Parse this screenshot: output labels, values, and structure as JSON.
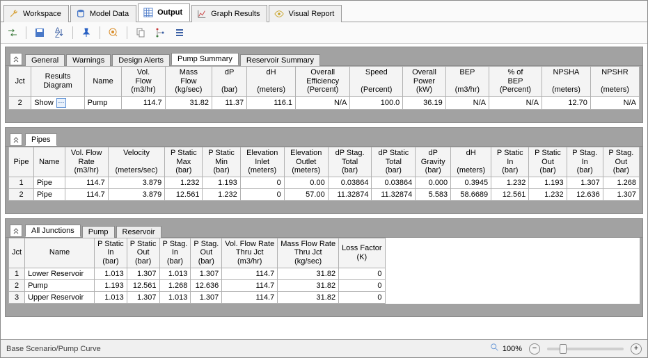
{
  "mainTabs": [
    {
      "label": "Workspace",
      "icon": "wrench"
    },
    {
      "label": "Model Data",
      "icon": "database"
    },
    {
      "label": "Output",
      "icon": "grid",
      "active": true
    },
    {
      "label": "Graph Results",
      "icon": "chart"
    },
    {
      "label": "Visual Report",
      "icon": "eye"
    }
  ],
  "panel1": {
    "subTabs": [
      "General",
      "Warnings",
      "Design Alerts",
      "Pump Summary",
      "Reservoir Summary"
    ],
    "activeSubTab": "Pump Summary",
    "headers": [
      {
        "l1": "Jct",
        "l2": ""
      },
      {
        "l1": "Results",
        "l2": "Diagram"
      },
      {
        "l1": "Name",
        "l2": ""
      },
      {
        "l1": "Vol.",
        "l2": "Flow",
        "l3": "(m3/hr)"
      },
      {
        "l1": "Mass",
        "l2": "Flow",
        "l3": "(kg/sec)"
      },
      {
        "l1": "dP",
        "l2": "",
        "l3": "(bar)"
      },
      {
        "l1": "dH",
        "l2": "",
        "l3": "(meters)"
      },
      {
        "l1": "Overall",
        "l2": "Efficiency",
        "l3": "(Percent)"
      },
      {
        "l1": "Speed",
        "l2": "",
        "l3": "(Percent)"
      },
      {
        "l1": "Overall",
        "l2": "Power",
        "l3": "(kW)"
      },
      {
        "l1": "BEP",
        "l2": "",
        "l3": "(m3/hr)"
      },
      {
        "l1": "% of",
        "l2": "BEP",
        "l3": "(Percent)"
      },
      {
        "l1": "NPSHA",
        "l2": "",
        "l3": "(meters)"
      },
      {
        "l1": "NPSHR",
        "l2": "",
        "l3": "(meters)"
      }
    ],
    "rows": [
      {
        "jct": "2",
        "show": "Show",
        "name": "Pump",
        "vol": "114.7",
        "mass": "31.82",
        "dp": "11.37",
        "dh": "116.1",
        "eff": "N/A",
        "speed": "100.0",
        "power": "36.19",
        "bep": "N/A",
        "pbep": "N/A",
        "npsha": "12.70",
        "npshr": "N/A"
      }
    ]
  },
  "panel2": {
    "subTabs": [
      "Pipes"
    ],
    "activeSubTab": "Pipes",
    "headers": [
      {
        "l1": "Pipe",
        "l2": ""
      },
      {
        "l1": "Name",
        "l2": ""
      },
      {
        "l1": "Vol. Flow",
        "l2": "Rate",
        "l3": "(m3/hr)"
      },
      {
        "l1": "Velocity",
        "l2": "",
        "l3": "(meters/sec)"
      },
      {
        "l1": "P Static",
        "l2": "Max",
        "l3": "(bar)"
      },
      {
        "l1": "P Static",
        "l2": "Min",
        "l3": "(bar)"
      },
      {
        "l1": "Elevation",
        "l2": "Inlet",
        "l3": "(meters)"
      },
      {
        "l1": "Elevation",
        "l2": "Outlet",
        "l3": "(meters)"
      },
      {
        "l1": "dP Stag.",
        "l2": "Total",
        "l3": "(bar)"
      },
      {
        "l1": "dP Static",
        "l2": "Total",
        "l3": "(bar)"
      },
      {
        "l1": "dP",
        "l2": "Gravity",
        "l3": "(bar)"
      },
      {
        "l1": "dH",
        "l2": "",
        "l3": "(meters)"
      },
      {
        "l1": "P Static",
        "l2": "In",
        "l3": "(bar)"
      },
      {
        "l1": "P Static",
        "l2": "Out",
        "l3": "(bar)"
      },
      {
        "l1": "P Stag.",
        "l2": "In",
        "l3": "(bar)"
      },
      {
        "l1": "P Stag.",
        "l2": "Out",
        "l3": "(bar)"
      }
    ],
    "rows": [
      {
        "p": "1",
        "name": "Pipe",
        "vol": "114.7",
        "vel": "3.879",
        "pmx": "1.232",
        "pmn": "1.193",
        "ei": "0",
        "eo": "0.00",
        "dpst": "0.03864",
        "dpstt": "0.03864",
        "dpg": "0.000",
        "dh": "0.3945",
        "psi": "1.232",
        "pso": "1.193",
        "pgi": "1.307",
        "pgo": "1.268"
      },
      {
        "p": "2",
        "name": "Pipe",
        "vol": "114.7",
        "vel": "3.879",
        "pmx": "12.561",
        "pmn": "1.232",
        "ei": "0",
        "eo": "57.00",
        "dpst": "11.32874",
        "dpstt": "11.32874",
        "dpg": "5.583",
        "dh": "58.6689",
        "psi": "12.561",
        "pso": "1.232",
        "pgi": "12.636",
        "pgo": "1.307"
      }
    ]
  },
  "panel3": {
    "subTabs": [
      "All Junctions",
      "Pump",
      "Reservoir"
    ],
    "activeSubTab": "All Junctions",
    "headers": [
      {
        "l1": "Jct",
        "l2": ""
      },
      {
        "l1": "Name",
        "l2": ""
      },
      {
        "l1": "P Static",
        "l2": "In",
        "l3": "(bar)"
      },
      {
        "l1": "P Static",
        "l2": "Out",
        "l3": "(bar)"
      },
      {
        "l1": "P Stag.",
        "l2": "In",
        "l3": "(bar)"
      },
      {
        "l1": "P Stag.",
        "l2": "Out",
        "l3": "(bar)"
      },
      {
        "l1": "Vol. Flow Rate",
        "l2": "Thru Jct",
        "l3": "(m3/hr)"
      },
      {
        "l1": "Mass Flow Rate",
        "l2": "Thru Jct",
        "l3": "(kg/sec)"
      },
      {
        "l1": "Loss Factor",
        "l2": "(K)"
      }
    ],
    "rows": [
      {
        "j": "1",
        "name": "Lower Reservoir",
        "psi": "1.013",
        "pso": "1.307",
        "pgi": "1.013",
        "pgo": "1.307",
        "vol": "114.7",
        "mass": "31.82",
        "lf": "0"
      },
      {
        "j": "2",
        "name": "Pump",
        "psi": "1.193",
        "pso": "12.561",
        "pgi": "1.268",
        "pgo": "12.636",
        "vol": "114.7",
        "mass": "31.82",
        "lf": "0"
      },
      {
        "j": "3",
        "name": "Upper Reservoir",
        "psi": "1.013",
        "pso": "1.307",
        "pgi": "1.013",
        "pgo": "1.307",
        "vol": "114.7",
        "mass": "31.82",
        "lf": "0"
      }
    ]
  },
  "status": {
    "scenario": "Base Scenario/Pump Curve",
    "zoom": "100%"
  }
}
